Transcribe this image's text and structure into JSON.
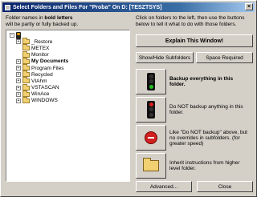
{
  "window": {
    "title": "Select Folders and Files For \"Proba\" On D: [TESZTSYS]",
    "close_glyph": "×"
  },
  "help": {
    "left_line1": "Folder names in ",
    "left_bold": "bold letters",
    "left_line2": "will be partly or fully backed up.",
    "right_text": "Click on folders to the left, then use the buttons below to tell it what to do with those folders."
  },
  "tree": {
    "items": [
      {
        "label": "",
        "root": true
      },
      {
        "label": "_Restore",
        "bold": false,
        "expandable": true
      },
      {
        "label": "METEX",
        "bold": false,
        "expandable": false
      },
      {
        "label": "Monitor",
        "bold": false,
        "expandable": false
      },
      {
        "label": "My Documents",
        "bold": true,
        "expandable": true
      },
      {
        "label": "Program Files",
        "bold": false,
        "expandable": true
      },
      {
        "label": "Recycled",
        "bold": false,
        "expandable": true
      },
      {
        "label": "VIAhm",
        "bold": false,
        "expandable": true
      },
      {
        "label": "VSTASCAN",
        "bold": false,
        "expandable": true
      },
      {
        "label": "WinAce",
        "bold": false,
        "expandable": true
      },
      {
        "label": "WINDOWS",
        "bold": false,
        "expandable": true
      }
    ]
  },
  "buttons": {
    "explain": "Explain This Window!",
    "show_hide_subfolders": "Show/Hide Subfolders",
    "space_required": "Space Required",
    "advanced": "Advanced...",
    "close": "Close"
  },
  "actions": [
    {
      "icon": "green-traffic-light-icon",
      "text": "Backup everything in this folder.",
      "bold": true
    },
    {
      "icon": "red-traffic-light-icon",
      "text": "Do NOT backup anything in this folder.",
      "bold": false
    },
    {
      "icon": "stop-sign-icon",
      "text": "Like \"Do NOT backup\" above, but no overrides in subfolders. (for greater speed)",
      "bold": false
    },
    {
      "icon": "folder-icon",
      "text": "Inherit instructions from higher level folder.",
      "bold": false
    }
  ],
  "colors": {
    "titlebar_start": "#0a246a",
    "folder": "#f0d070",
    "green_lamp": "#20c020",
    "red_lamp": "#e02020"
  }
}
